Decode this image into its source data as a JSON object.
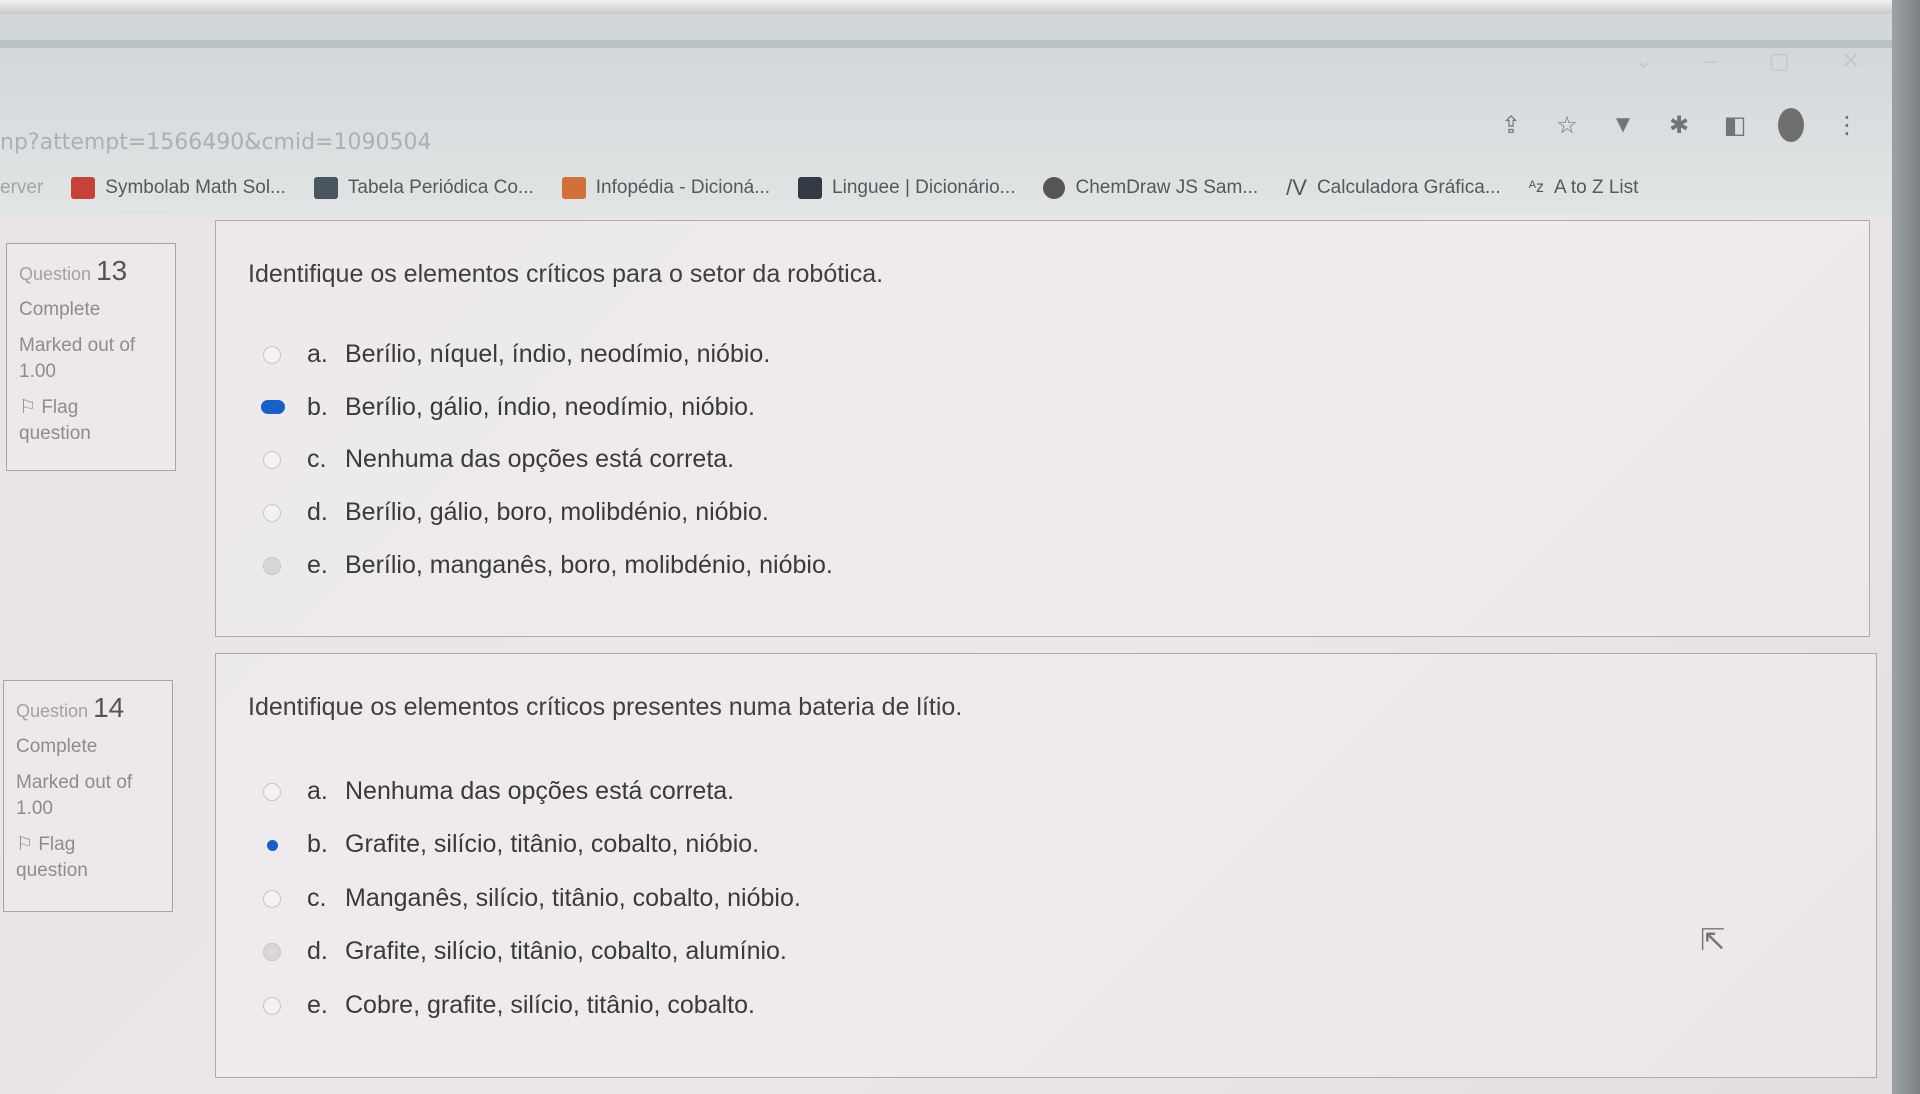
{
  "browser": {
    "url": "np?attempt=1566490&cmid=1090504",
    "window_controls": [
      "⌄",
      "–",
      "▢",
      "✕"
    ],
    "toolbar_icons": [
      "share-icon",
      "star-icon",
      "extension-icon",
      "puzzle-icon",
      "sidepanel-icon",
      "avatar",
      "menu-icon"
    ],
    "bookmarks": [
      {
        "label": "erver",
        "icon": "none"
      },
      {
        "label": "Symbolab Math Sol...",
        "icon": "symbolab-icon",
        "color": "#c4423a"
      },
      {
        "label": "Tabela Periódica Co...",
        "icon": "periodic-table-icon",
        "color": "#4a5560"
      },
      {
        "label": "Infopédia - Dicioná...",
        "icon": "infopedia-icon",
        "color": "#d2703a"
      },
      {
        "label": "Linguee | Dicionário...",
        "icon": "linguee-icon",
        "color": "#333a44"
      },
      {
        "label": "ChemDraw JS Sam...",
        "icon": "chemdraw-icon",
        "color": "#555555"
      },
      {
        "label": "Calculadora Gráfica...",
        "icon": "desmos-icon",
        "color": "#555555"
      },
      {
        "label": "A to Z List",
        "icon": "az-icon",
        "color": "#555555"
      }
    ]
  },
  "questions": [
    {
      "number_prefix": "Question",
      "number": "13",
      "status": "Complete",
      "marked": "Marked out of",
      "marked_value": "1.00",
      "flag_label": "Flag",
      "flag_label2": "question",
      "text": "Identifique os elementos críticos para o setor da robótica.",
      "options": [
        {
          "letter": "a.",
          "text": "Berílio, níquel, índio, neodímio, nióbio.",
          "selected": false
        },
        {
          "letter": "b.",
          "text": "Berílio, gálio, índio, neodímio, nióbio.",
          "selected": true
        },
        {
          "letter": "c.",
          "text": "Nenhuma das opções está correta.",
          "selected": false
        },
        {
          "letter": "d.",
          "text": "Berílio, gálio, boro, molibdénio, nióbio.",
          "selected": false
        },
        {
          "letter": "e.",
          "text": "Berílio, manganês, boro, molibdénio, nióbio.",
          "selected": false
        }
      ]
    },
    {
      "number_prefix": "Question",
      "number": "14",
      "status": "Complete",
      "marked": "Marked out of",
      "marked_value": "1.00",
      "flag_label": "Flag",
      "flag_label2": "question",
      "text": "Identifique os elementos críticos presentes numa bateria de lítio.",
      "options": [
        {
          "letter": "a.",
          "text": "Nenhuma das opções está correta.",
          "selected": false
        },
        {
          "letter": "b.",
          "text": "Grafite, silício, titânio, cobalto, nióbio.",
          "selected": true
        },
        {
          "letter": "c.",
          "text": "Manganês, silício, titânio, cobalto, nióbio.",
          "selected": false
        },
        {
          "letter": "d.",
          "text": "Grafite, silício, titânio, cobalto, alumínio.",
          "selected": false
        },
        {
          "letter": "e.",
          "text": "Cobre, grafite, silício, titânio, cobalto.",
          "selected": false
        }
      ]
    }
  ],
  "colors": {
    "selected_radio": "#1a5fc6"
  }
}
